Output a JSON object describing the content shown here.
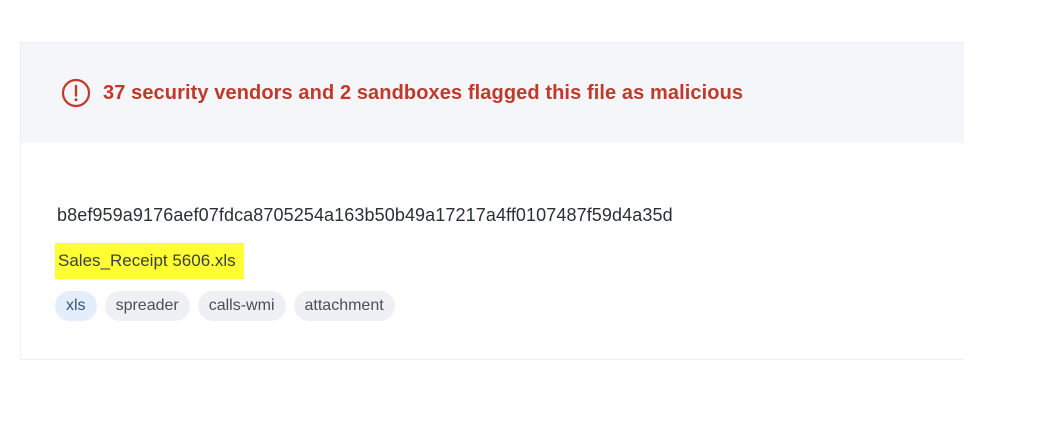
{
  "alert": {
    "icon": "exclamation-circle-icon",
    "text": "37 security vendors and 2 sandboxes flagged this file as malicious",
    "color": "#c0392b"
  },
  "file": {
    "hash": "b8ef959a9176aef07fdca8705254a163b50b49a17217a4ff0107487f59d4a35d",
    "name": "Sales_Receipt 5606.xls",
    "highlight_color": "#ffff33"
  },
  "tags": [
    {
      "label": "xls"
    },
    {
      "label": "spreader"
    },
    {
      "label": "calls-wmi"
    },
    {
      "label": "attachment"
    }
  ]
}
